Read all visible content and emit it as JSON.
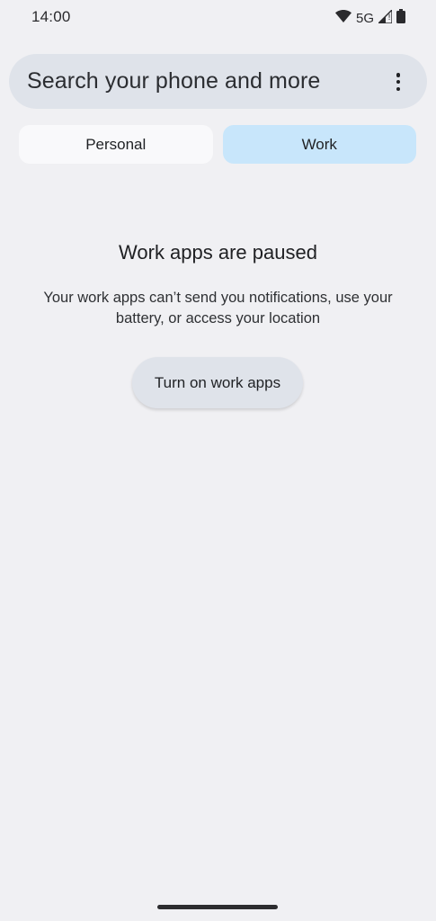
{
  "status_bar": {
    "time": "14:00",
    "network": "5G",
    "icons": [
      "wifi-icon",
      "signal-icon",
      "battery-icon"
    ]
  },
  "search": {
    "placeholder": "Search your phone and more",
    "more_icon": "more-vert-icon"
  },
  "tabs": [
    {
      "label": "Personal",
      "selected": false
    },
    {
      "label": "Work",
      "selected": true
    }
  ],
  "paused": {
    "title": "Work apps are paused",
    "description": "Your work apps can’t send you notifications, use your battery, or access your location",
    "button_label": "Turn on work apps"
  },
  "colors": {
    "background": "#f0f0f3",
    "search_bg": "#dfe3ea",
    "tab_selected": "#c8e6fb",
    "tab_unselected": "#f9f9fb"
  }
}
